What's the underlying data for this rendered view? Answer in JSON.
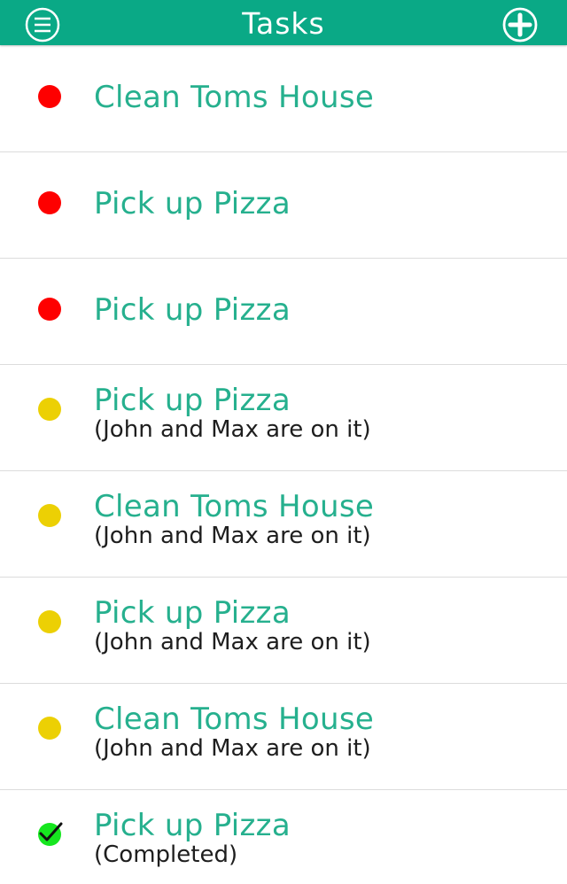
{
  "header": {
    "title": "Tasks",
    "menu_icon": "menu-circle-icon",
    "add_icon": "plus-circle-icon",
    "background_color": "#0aa986"
  },
  "colors": {
    "title_text": "#26b08e",
    "status_open": "#fe0000",
    "status_in_progress": "#ecd004",
    "status_completed": "#16e61f"
  },
  "tasks": [
    {
      "title": "Clean Toms House",
      "status": "open",
      "subtitle": ""
    },
    {
      "title": "Pick up Pizza",
      "status": "open",
      "subtitle": ""
    },
    {
      "title": "Pick up Pizza",
      "status": "open",
      "subtitle": ""
    },
    {
      "title": "Pick up Pizza",
      "status": "in-progress",
      "subtitle": "(John and Max are on it)"
    },
    {
      "title": "Clean Toms House",
      "status": "in-progress",
      "subtitle": "(John and Max are on it)"
    },
    {
      "title": "Pick up Pizza",
      "status": "in-progress",
      "subtitle": "(John and Max are on it)"
    },
    {
      "title": "Clean Toms House",
      "status": "in-progress",
      "subtitle": "(John and Max are on it)"
    },
    {
      "title": "Pick up Pizza",
      "status": "completed",
      "subtitle": "(Completed)"
    }
  ]
}
